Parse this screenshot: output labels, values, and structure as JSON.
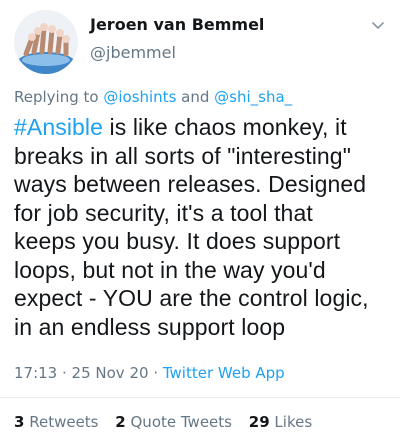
{
  "author": {
    "name": "Jeroen van Bemmel",
    "handle": "@jbemmel"
  },
  "reply": {
    "prefix": "Replying to ",
    "user1": "@ioshints",
    "conjunction": " and ",
    "user2": "@shi_sha_"
  },
  "tweet": {
    "hashtag": "#Ansible",
    "lines": [
      " is like chaos monkey, it",
      "breaks in all sorts of \"interesting\"",
      "ways between releases. Designed",
      "for job security, it's a tool that",
      "keeps you busy. It does support",
      "loops, but not in the way you'd",
      "expect - YOU are the control logic,",
      "in an endless support loop"
    ]
  },
  "meta": {
    "time": "17:13",
    "sep1": " · ",
    "date": "25 Nov 20",
    "sep2": " · ",
    "source": "Twitter Web App"
  },
  "stats": {
    "retweets_count": "3",
    "retweets_label": "Retweets",
    "quotes_count": "2",
    "quotes_label": "Quote Tweets",
    "likes_count": "29",
    "likes_label": "Likes"
  },
  "colors": {
    "link": "#1da1f2",
    "muted": "#657786",
    "text": "#14171a"
  },
  "icons": {
    "menu": "chevron-down-icon",
    "avatar": "avatar-image"
  }
}
